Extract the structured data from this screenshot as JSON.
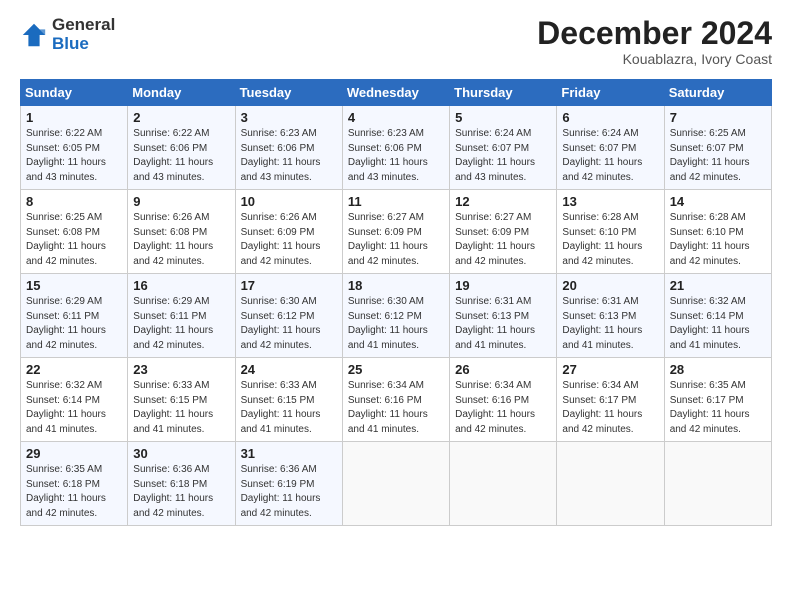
{
  "logo": {
    "general": "General",
    "blue": "Blue"
  },
  "header": {
    "month_year": "December 2024",
    "location": "Kouablazra, Ivory Coast"
  },
  "days_of_week": [
    "Sunday",
    "Monday",
    "Tuesday",
    "Wednesday",
    "Thursday",
    "Friday",
    "Saturday"
  ],
  "weeks": [
    [
      {
        "day": "1",
        "rise": "6:22 AM",
        "set": "6:05 PM",
        "hours": "11 hours and 43 minutes."
      },
      {
        "day": "2",
        "rise": "6:22 AM",
        "set": "6:06 PM",
        "hours": "11 hours and 43 minutes."
      },
      {
        "day": "3",
        "rise": "6:23 AM",
        "set": "6:06 PM",
        "hours": "11 hours and 43 minutes."
      },
      {
        "day": "4",
        "rise": "6:23 AM",
        "set": "6:06 PM",
        "hours": "11 hours and 43 minutes."
      },
      {
        "day": "5",
        "rise": "6:24 AM",
        "set": "6:07 PM",
        "hours": "11 hours and 43 minutes."
      },
      {
        "day": "6",
        "rise": "6:24 AM",
        "set": "6:07 PM",
        "hours": "11 hours and 42 minutes."
      },
      {
        "day": "7",
        "rise": "6:25 AM",
        "set": "6:07 PM",
        "hours": "11 hours and 42 minutes."
      }
    ],
    [
      {
        "day": "8",
        "rise": "6:25 AM",
        "set": "6:08 PM",
        "hours": "11 hours and 42 minutes."
      },
      {
        "day": "9",
        "rise": "6:26 AM",
        "set": "6:08 PM",
        "hours": "11 hours and 42 minutes."
      },
      {
        "day": "10",
        "rise": "6:26 AM",
        "set": "6:09 PM",
        "hours": "11 hours and 42 minutes."
      },
      {
        "day": "11",
        "rise": "6:27 AM",
        "set": "6:09 PM",
        "hours": "11 hours and 42 minutes."
      },
      {
        "day": "12",
        "rise": "6:27 AM",
        "set": "6:09 PM",
        "hours": "11 hours and 42 minutes."
      },
      {
        "day": "13",
        "rise": "6:28 AM",
        "set": "6:10 PM",
        "hours": "11 hours and 42 minutes."
      },
      {
        "day": "14",
        "rise": "6:28 AM",
        "set": "6:10 PM",
        "hours": "11 hours and 42 minutes."
      }
    ],
    [
      {
        "day": "15",
        "rise": "6:29 AM",
        "set": "6:11 PM",
        "hours": "11 hours and 42 minutes."
      },
      {
        "day": "16",
        "rise": "6:29 AM",
        "set": "6:11 PM",
        "hours": "11 hours and 42 minutes."
      },
      {
        "day": "17",
        "rise": "6:30 AM",
        "set": "6:12 PM",
        "hours": "11 hours and 42 minutes."
      },
      {
        "day": "18",
        "rise": "6:30 AM",
        "set": "6:12 PM",
        "hours": "11 hours and 41 minutes."
      },
      {
        "day": "19",
        "rise": "6:31 AM",
        "set": "6:13 PM",
        "hours": "11 hours and 41 minutes."
      },
      {
        "day": "20",
        "rise": "6:31 AM",
        "set": "6:13 PM",
        "hours": "11 hours and 41 minutes."
      },
      {
        "day": "21",
        "rise": "6:32 AM",
        "set": "6:14 PM",
        "hours": "11 hours and 41 minutes."
      }
    ],
    [
      {
        "day": "22",
        "rise": "6:32 AM",
        "set": "6:14 PM",
        "hours": "11 hours and 41 minutes."
      },
      {
        "day": "23",
        "rise": "6:33 AM",
        "set": "6:15 PM",
        "hours": "11 hours and 41 minutes."
      },
      {
        "day": "24",
        "rise": "6:33 AM",
        "set": "6:15 PM",
        "hours": "11 hours and 41 minutes."
      },
      {
        "day": "25",
        "rise": "6:34 AM",
        "set": "6:16 PM",
        "hours": "11 hours and 41 minutes."
      },
      {
        "day": "26",
        "rise": "6:34 AM",
        "set": "6:16 PM",
        "hours": "11 hours and 42 minutes."
      },
      {
        "day": "27",
        "rise": "6:34 AM",
        "set": "6:17 PM",
        "hours": "11 hours and 42 minutes."
      },
      {
        "day": "28",
        "rise": "6:35 AM",
        "set": "6:17 PM",
        "hours": "11 hours and 42 minutes."
      }
    ],
    [
      {
        "day": "29",
        "rise": "6:35 AM",
        "set": "6:18 PM",
        "hours": "11 hours and 42 minutes."
      },
      {
        "day": "30",
        "rise": "6:36 AM",
        "set": "6:18 PM",
        "hours": "11 hours and 42 minutes."
      },
      {
        "day": "31",
        "rise": "6:36 AM",
        "set": "6:19 PM",
        "hours": "11 hours and 42 minutes."
      },
      null,
      null,
      null,
      null
    ]
  ],
  "labels": {
    "sunrise": "Sunrise:",
    "sunset": "Sunset:",
    "daylight": "Daylight:"
  }
}
